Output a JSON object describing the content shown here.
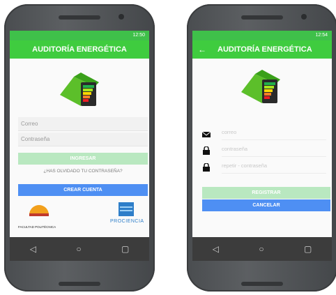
{
  "left": {
    "status_time": "12:50",
    "app_title": "AUDITORÍA ENERGÉTICA",
    "fields": {
      "email_placeholder": "Correo",
      "password_placeholder": "Contraseña"
    },
    "buttons": {
      "login": "INGRESAR",
      "create": "CREAR CUENTA"
    },
    "forgot": "¿HAS OLVIDADO TU CONTRASEÑA?",
    "logos": {
      "left_caption": "FACULTAD POLITÉCNICA",
      "right_caption": "PROCIENCIA"
    }
  },
  "right": {
    "status_time": "12:54",
    "app_title": "AUDITORÍA ENERGÉTICA",
    "fields": {
      "email": "correo",
      "password": "contraseña",
      "repeat": "repetir - contraseña"
    },
    "buttons": {
      "register": "REGISTRAR",
      "cancel": "CANCELAR"
    }
  },
  "nav": {
    "back_icon": "◁",
    "home_icon": "○",
    "recent_icon": "▢"
  },
  "colors": {
    "green": "#3fcc3f",
    "light_green": "#b9e8c0",
    "blue": "#4e8ff3"
  }
}
